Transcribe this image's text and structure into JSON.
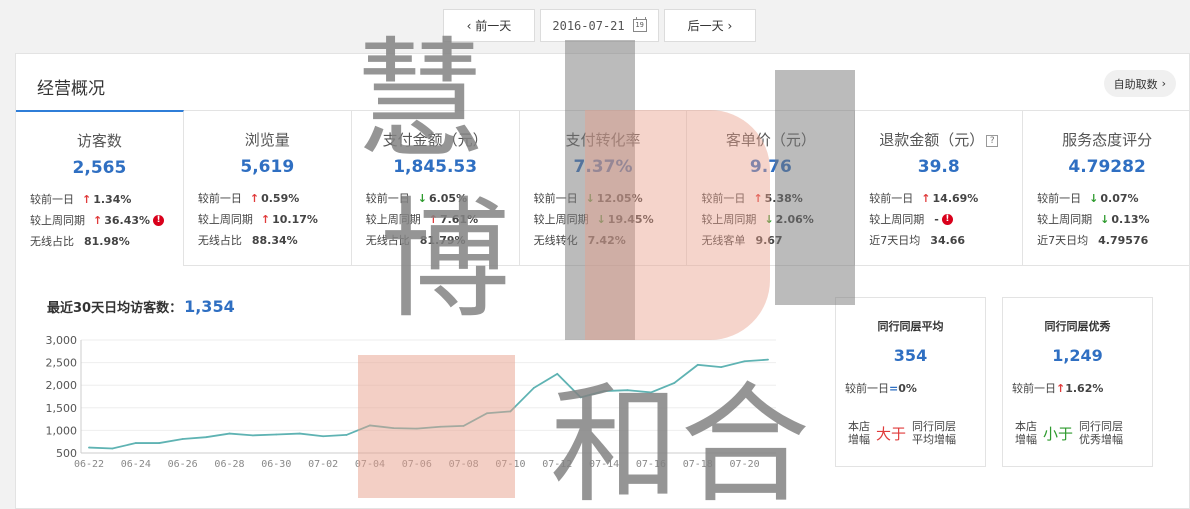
{
  "date_nav": {
    "prev_label": "前一天",
    "date": "2016-07-21",
    "calendar_day": "19",
    "next_label": "后一天"
  },
  "panel": {
    "title": "经营概况",
    "self_fetch_label": "自助取数"
  },
  "metrics": [
    {
      "title": "访客数",
      "value": "2,565",
      "rows": [
        {
          "label": "较前一日",
          "dir": "up",
          "value": "1.34%"
        },
        {
          "label": "较上周同期",
          "dir": "up",
          "value": "36.43%",
          "warn": true
        },
        {
          "label": "无线占比",
          "value": "81.98%"
        }
      ]
    },
    {
      "title": "浏览量",
      "value": "5,619",
      "rows": [
        {
          "label": "较前一日",
          "dir": "up",
          "value": "0.59%"
        },
        {
          "label": "较上周同期",
          "dir": "up",
          "value": "10.17%"
        },
        {
          "label": "无线占比",
          "value": "88.34%"
        }
      ]
    },
    {
      "title": "支付金额（元）",
      "value": "1,845.53",
      "rows": [
        {
          "label": "较前一日",
          "dir": "down",
          "value": "6.05%"
        },
        {
          "label": "较上周同期",
          "dir": "up",
          "value": "7.61%"
        },
        {
          "label": "无线占比",
          "value": "81.79%"
        }
      ]
    },
    {
      "title": "支付转化率",
      "value": "7.37%",
      "rows": [
        {
          "label": "较前一日",
          "dir": "down",
          "value": "12.05%"
        },
        {
          "label": "较上周同期",
          "dir": "down",
          "value": "19.45%"
        },
        {
          "label": "无线转化",
          "value": "7.42%"
        }
      ]
    },
    {
      "title": "客单价（元）",
      "value": "9.76",
      "rows": [
        {
          "label": "较前一日",
          "dir": "up",
          "value": "5.38%"
        },
        {
          "label": "较上周同期",
          "dir": "down",
          "value": "2.06%"
        },
        {
          "label": "无线客单",
          "value": "9.67"
        }
      ]
    },
    {
      "title": "退款金额（元）",
      "value": "39.8",
      "help": "?",
      "rows": [
        {
          "label": "较前一日",
          "dir": "up",
          "value": "14.69%"
        },
        {
          "label": "较上周同期",
          "value": "-",
          "warn": true
        },
        {
          "label": "近7天日均",
          "value": "34.66"
        }
      ]
    },
    {
      "title": "服务态度评分",
      "value": "4.79282",
      "rows": [
        {
          "label": "较前一日",
          "dir": "down",
          "value": "0.07%"
        },
        {
          "label": "较上周同期",
          "dir": "down",
          "value": "0.13%"
        },
        {
          "label": "近7天日均",
          "value": "4.79576"
        }
      ]
    }
  ],
  "avg": {
    "label": "最近30天日均访客数：",
    "value": "1,354"
  },
  "chart_data": {
    "type": "line",
    "x": [
      "06-22",
      "06-23",
      "06-24",
      "06-25",
      "06-26",
      "06-27",
      "06-28",
      "06-29",
      "06-30",
      "07-01",
      "07-02",
      "07-03",
      "07-04",
      "07-05",
      "07-06",
      "07-07",
      "07-08",
      "07-09",
      "07-10",
      "07-11",
      "07-12",
      "07-13",
      "07-14",
      "07-15",
      "07-16",
      "07-17",
      "07-18",
      "07-19",
      "07-20",
      "07-21"
    ],
    "xticks": [
      "06-22",
      "06-24",
      "06-26",
      "06-28",
      "06-30",
      "07-02",
      "07-04",
      "07-06",
      "07-08",
      "07-10",
      "07-12",
      "07-14",
      "07-16",
      "07-18",
      "07-20"
    ],
    "yticks": [
      "500",
      "1,000",
      "1,500",
      "2,000",
      "2,500",
      "3,000"
    ],
    "ylim": [
      500,
      3000
    ],
    "series": [
      {
        "values": [
          620,
          600,
          720,
          720,
          810,
          850,
          930,
          890,
          910,
          930,
          870,
          900,
          1110,
          1050,
          1040,
          1080,
          1100,
          1380,
          1420,
          1940,
          2250,
          1730,
          1870,
          1890,
          1840,
          2050,
          2450,
          2400,
          2530,
          2565
        ],
        "color": "#5fb3b3"
      }
    ],
    "grid": true
  },
  "compare": [
    {
      "title": "同行同层平均",
      "value": "354",
      "row_label": "较前一日",
      "row_symbol": "=",
      "row_value": "0%",
      "foot_left": [
        "本店",
        "增幅"
      ],
      "foot_mid": "大于",
      "foot_mid_color": "red",
      "foot_right": [
        "同行同层",
        "平均增幅"
      ]
    },
    {
      "title": "同行同层优秀",
      "value": "1,249",
      "row_label": "较前一日",
      "row_symbol": "↑",
      "row_value": "1.62%",
      "foot_left": [
        "本店",
        "增幅"
      ],
      "foot_mid": "小于",
      "foot_mid_color": "green",
      "foot_right": [
        "同行同层",
        "优秀增幅"
      ]
    }
  ],
  "watermark": [
    "慧",
    "博",
    "和合"
  ]
}
